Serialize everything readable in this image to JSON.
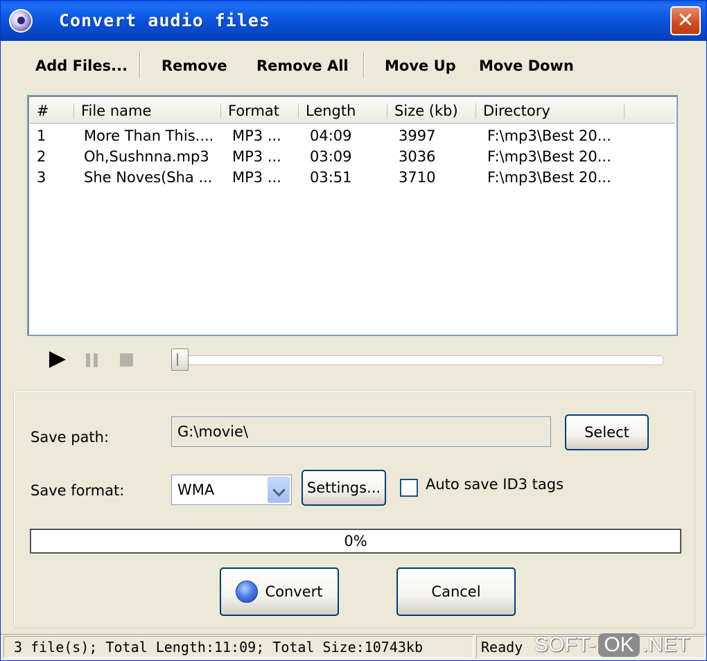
{
  "window": {
    "title": "Convert audio files",
    "close_label": "✕"
  },
  "toolbar": {
    "add_files": "Add Files...",
    "remove": "Remove",
    "remove_all": "Remove All",
    "move_up": "Move Up",
    "move_down": "Move Down"
  },
  "file_list": {
    "columns": [
      "#",
      "File name",
      "Format",
      "Length",
      "Size (kb)",
      "Directory"
    ],
    "rows": [
      {
        "num": "1",
        "name": "More Than This....",
        "format": "MP3 ...",
        "length": "04:09",
        "size": "3997",
        "directory": "F:\\mp3\\Best 20..."
      },
      {
        "num": "2",
        "name": "Oh,Sushnna.mp3",
        "format": "MP3 ...",
        "length": "03:09",
        "size": "3036",
        "directory": "F:\\mp3\\Best 20..."
      },
      {
        "num": "3",
        "name": "She Noves(Sha ...",
        "format": "MP3 ...",
        "length": "03:51",
        "size": "3710",
        "directory": "F:\\mp3\\Best 20..."
      }
    ]
  },
  "player": {
    "seek_position": 0
  },
  "options": {
    "save_path_label": "Save path:",
    "save_path_value": "G:\\movie\\",
    "select_label": "Select",
    "save_format_label": "Save format:",
    "save_format_value": "WMA",
    "settings_label": "Settings...",
    "id3_label": "Auto save ID3 tags",
    "id3_checked": false
  },
  "progress": {
    "value": 0,
    "text": "0%"
  },
  "actions": {
    "convert_label": "Convert",
    "cancel_label": "Cancel"
  },
  "status": {
    "left": "3 file(s); Total Length:11:09; Total Size:10743kb",
    "right": "Ready"
  },
  "watermark": {
    "part1": "SOFT-",
    "part2": "OK",
    "part3": ".NET"
  },
  "colors": {
    "title_bar": "#0a5ae6",
    "progress_fill": "#2bb83d",
    "close_button": "#d24a21"
  }
}
